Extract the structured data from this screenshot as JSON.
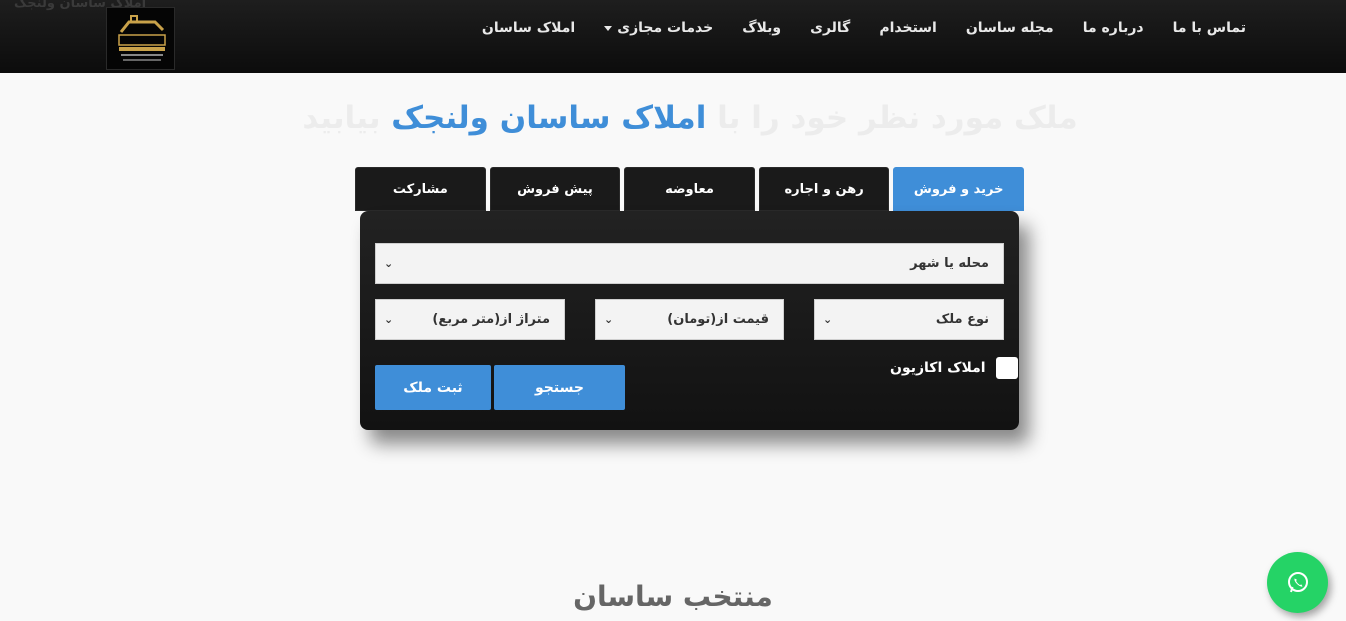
{
  "header": {
    "ghost_title": "املاک ساسان ولنجک",
    "nav": [
      {
        "label": "املاک ساسان"
      },
      {
        "label": "خدمات مجازی",
        "has_dropdown": true
      },
      {
        "label": "وبلاگ"
      },
      {
        "label": "گالری"
      },
      {
        "label": "استخدام"
      },
      {
        "label": "مجله ساسان"
      },
      {
        "label": "درباره ما"
      },
      {
        "label": "تماس با ما"
      }
    ]
  },
  "hero": {
    "title_before": "ملک مورد نظر خود را با ",
    "title_accent": "املاک ساسان ولنجک",
    "title_after": " بیابید"
  },
  "tabs": [
    {
      "label": "خرید و فروش",
      "active": true
    },
    {
      "label": "رهن و اجاره",
      "active": false
    },
    {
      "label": "معاوضه",
      "active": false
    },
    {
      "label": "پیش فروش",
      "active": false
    },
    {
      "label": "مشارکت",
      "active": false
    }
  ],
  "search": {
    "location_select": "محله یا شهر",
    "property_type_select": "نوع ملک",
    "price_select": "قیمت از(تومان)",
    "area_select": "متراژ از(متر مربع)",
    "occasion_checkbox_label": "املاک اکازیون",
    "search_button": "جستجو",
    "register_button": "ثبت ملک"
  },
  "section": {
    "title": "منتخب ساسان"
  },
  "colors": {
    "accent": "#3f8ed8",
    "whatsapp": "#25d366",
    "navbar": "#141414"
  }
}
